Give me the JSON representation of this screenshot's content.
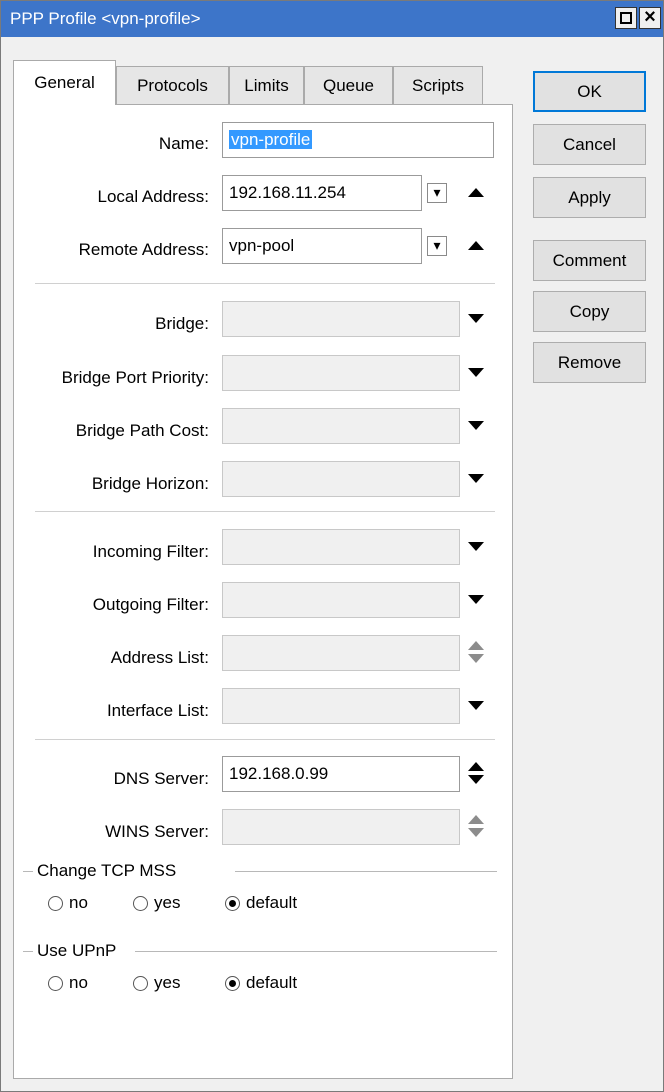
{
  "window": {
    "title": "PPP Profile <vpn-profile>"
  },
  "titlebar_icons": [
    "maximize-icon",
    "close-icon"
  ],
  "tabs": [
    {
      "label": "General",
      "active": true
    },
    {
      "label": "Protocols",
      "active": false
    },
    {
      "label": "Limits",
      "active": false
    },
    {
      "label": "Queue",
      "active": false
    },
    {
      "label": "Scripts",
      "active": false
    }
  ],
  "fields": {
    "name": {
      "label": "Name:",
      "value": "vpn-profile"
    },
    "local_address": {
      "label": "Local Address:",
      "value": "192.168.11.254"
    },
    "remote_address": {
      "label": "Remote Address:",
      "value": "vpn-pool"
    },
    "bridge": {
      "label": "Bridge:",
      "value": ""
    },
    "bridge_port_priority": {
      "label": "Bridge Port Priority:",
      "value": ""
    },
    "bridge_path_cost": {
      "label": "Bridge Path Cost:",
      "value": ""
    },
    "bridge_horizon": {
      "label": "Bridge Horizon:",
      "value": ""
    },
    "incoming_filter": {
      "label": "Incoming Filter:",
      "value": ""
    },
    "outgoing_filter": {
      "label": "Outgoing Filter:",
      "value": ""
    },
    "address_list": {
      "label": "Address List:",
      "value": ""
    },
    "interface_list": {
      "label": "Interface List:",
      "value": ""
    },
    "dns_server": {
      "label": "DNS Server:",
      "value": "192.168.0.99"
    },
    "wins_server": {
      "label": "WINS Server:",
      "value": ""
    }
  },
  "change_tcp_mss": {
    "title": "Change TCP MSS",
    "options": [
      "no",
      "yes",
      "default"
    ],
    "selected": "default"
  },
  "use_upnp": {
    "title": "Use UPnP",
    "options": [
      "no",
      "yes",
      "default"
    ],
    "selected": "default"
  },
  "buttons": {
    "ok": "OK",
    "cancel": "Cancel",
    "apply": "Apply",
    "comment": "Comment",
    "copy": "Copy",
    "remove": "Remove"
  },
  "colors": {
    "titlebar": "#3d75c9",
    "selection": "#3399ff",
    "default_button_border": "#0078d7"
  }
}
